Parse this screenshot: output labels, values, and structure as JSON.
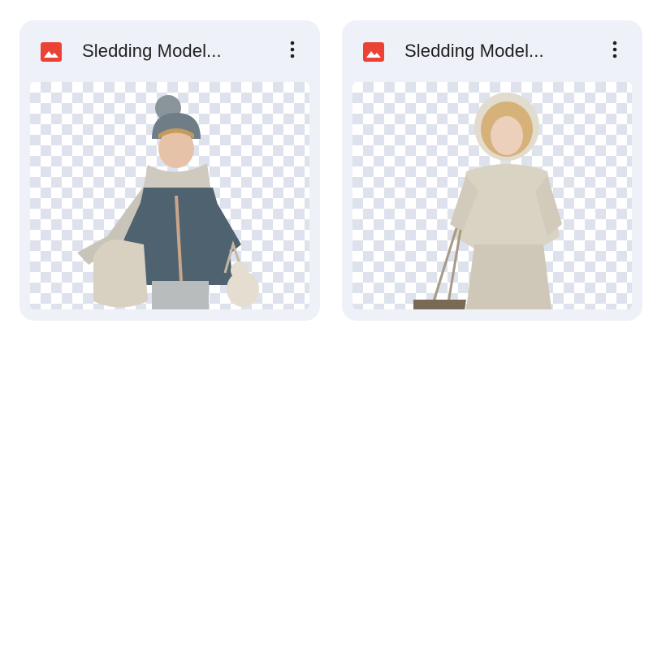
{
  "files": [
    {
      "title": "Sledding Model...",
      "icon": "image-file-icon",
      "menu_icon": "more-vert-icon",
      "thumbnail": "child-blue-coat-scarf-image"
    },
    {
      "title": "Sledding Model...",
      "icon": "image-file-icon",
      "menu_icon": "more-vert-icon",
      "thumbnail": "child-fleece-suit-sled-image"
    }
  ],
  "colors": {
    "card_background": "#eef1f7",
    "image_icon": "#ea4335",
    "title_text": "#1f1f1f",
    "checker": "#dde2ec"
  }
}
